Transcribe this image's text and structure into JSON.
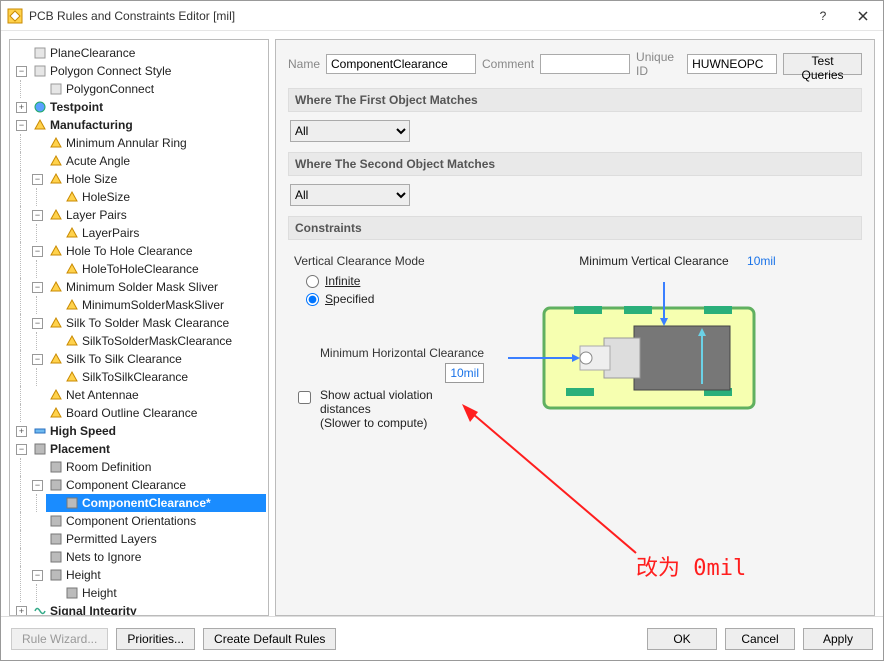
{
  "window": {
    "title": "PCB Rules and Constraints Editor [mil]"
  },
  "tree": {
    "plane_clearance": "PlaneClearance",
    "polygon_connect_style": "Polygon Connect Style",
    "polygon_connect": "PolygonConnect",
    "testpoint": "Testpoint",
    "manufacturing": "Manufacturing",
    "min_annular_ring": "Minimum Annular Ring",
    "acute_angle": "Acute Angle",
    "hole_size": "Hole Size",
    "hole_size_child": "HoleSize",
    "layer_pairs": "Layer Pairs",
    "layer_pairs_child": "LayerPairs",
    "hole_to_hole": "Hole To Hole Clearance",
    "hole_to_hole_child": "HoleToHoleClearance",
    "min_solder_mask": "Minimum Solder Mask Sliver",
    "min_solder_mask_child": "MinimumSolderMaskSliver",
    "silk_solder": "Silk To Solder Mask Clearance",
    "silk_solder_child": "SilkToSolderMaskClearance",
    "silk_silk": "Silk To Silk Clearance",
    "silk_silk_child": "SilkToSilkClearance",
    "net_antennae": "Net Antennae",
    "board_outline": "Board Outline Clearance",
    "high_speed": "High Speed",
    "placement": "Placement",
    "room_def": "Room Definition",
    "comp_clearance": "Component Clearance",
    "comp_clearance_child": "ComponentClearance*",
    "comp_orient": "Component Orientations",
    "permitted_layers": "Permitted Layers",
    "nets_ignore": "Nets to Ignore",
    "height": "Height",
    "height_child": "Height",
    "signal_integrity": "Signal Integrity"
  },
  "form": {
    "name_label": "Name",
    "name_value": "ComponentClearance",
    "comment_label": "Comment",
    "comment_value": "",
    "uid_label": "Unique ID",
    "uid_value": "HUWNEOPC",
    "test_queries": "Test Queries"
  },
  "sections": {
    "first_match": "Where The First Object Matches",
    "second_match": "Where The Second Object Matches",
    "constraints": "Constraints",
    "match_value": "All"
  },
  "constraints": {
    "vcm_label": "Vertical Clearance Mode",
    "infinite": "Infinite",
    "specified": "Specified",
    "min_h_label": "Minimum Horizontal Clearance",
    "min_h_value": "10mil",
    "min_v_label": "Minimum Vertical Clearance",
    "min_v_value": "10mil",
    "show_violation": "Show actual violation distances",
    "show_violation2": "(Slower to compute)"
  },
  "footer": {
    "rule_wizard": "Rule Wizard...",
    "priorities": "Priorities...",
    "create_default": "Create Default Rules",
    "ok": "OK",
    "cancel": "Cancel",
    "apply": "Apply"
  },
  "annotation": {
    "text": "改为 0mil"
  }
}
